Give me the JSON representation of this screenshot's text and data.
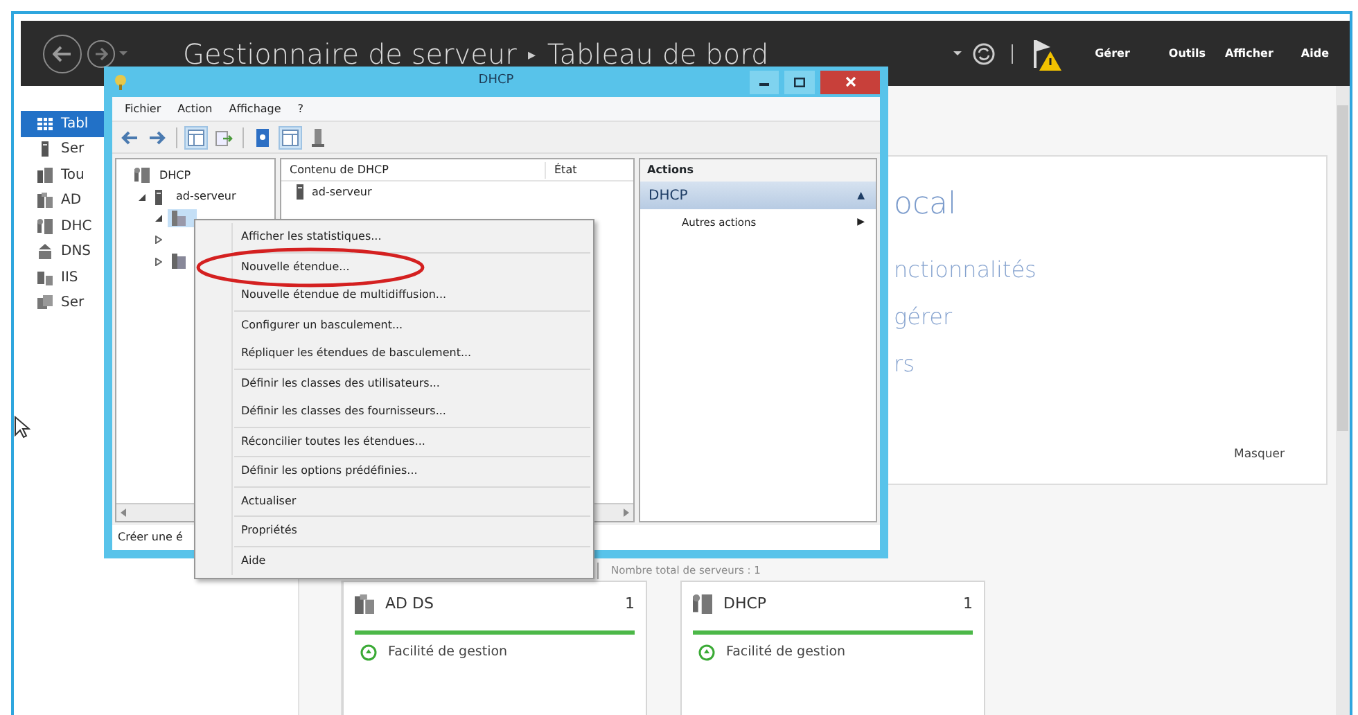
{
  "manager": {
    "breadcrumb": [
      "Gestionnaire de serveur",
      "Tableau de bord"
    ],
    "separator": "▸",
    "menu": [
      "Gérer",
      "Outils",
      "Afficher",
      "Aide"
    ],
    "sidebar": [
      {
        "label": "Tabl",
        "kind": "grid",
        "selected": true
      },
      {
        "label": "Ser",
        "kind": "server",
        "selected": false
      },
      {
        "label": "Tou",
        "kind": "servers",
        "selected": false
      },
      {
        "label": "AD",
        "kind": "adds",
        "selected": false
      },
      {
        "label": "DHC",
        "kind": "dhcp",
        "selected": false
      },
      {
        "label": "DNS",
        "kind": "dns",
        "selected": false
      },
      {
        "label": "IIS",
        "kind": "iis",
        "selected": false
      },
      {
        "label": "Ser",
        "kind": "files",
        "selected": false
      }
    ],
    "welcome": {
      "heading": "ocal",
      "links": [
        "nctionnalités",
        "gérer",
        "rs"
      ],
      "hide": "Masquer"
    },
    "server_count": "Nombre total de serveurs : 1",
    "tiles": [
      {
        "title": "AD DS",
        "count": "1",
        "kind": "adds",
        "status": "Facilité de gestion",
        "healthy": true
      },
      {
        "title": "DHCP",
        "count": "1",
        "kind": "dhcp",
        "status": "Facilité de gestion",
        "healthy": true
      }
    ]
  },
  "dhcp_window": {
    "title": "DHCP",
    "menu": [
      "Fichier",
      "Action",
      "Affichage",
      "?"
    ],
    "tree": [
      {
        "label": "DHCP",
        "kind": "dhcp",
        "selected": false,
        "children": [
          {
            "label": "ad-serveur",
            "kind": "server",
            "expanded": true,
            "selected": false,
            "children": [
              {
                "kind": "ipv4",
                "expanded": true,
                "selected": true
              },
              {
                "expanded": false,
                "selected": false
              },
              {
                "kind": "ipv6",
                "expanded": false,
                "selected": false
              }
            ]
          }
        ]
      }
    ],
    "content": {
      "columns": [
        "Contenu de DHCP",
        "État"
      ],
      "rows": [
        {
          "name": "ad-serveur"
        }
      ]
    },
    "actions": {
      "header": "Actions",
      "section": "DHCP",
      "section_caret": "▲",
      "items": [
        {
          "label": "Autres actions",
          "arrow": "▶"
        }
      ]
    },
    "status": "Créer une é"
  },
  "context_menu": {
    "groups": [
      [
        {
          "label": "Afficher les statistiques...",
          "highlighted": false
        }
      ],
      [
        {
          "label": "Nouvelle étendue...",
          "highlighted": true
        },
        {
          "label": "Nouvelle étendue de multidiffusion...",
          "highlighted": false
        }
      ],
      [
        {
          "label": "Configurer un basculement...",
          "highlighted": false
        },
        {
          "label": "Répliquer les étendues de basculement...",
          "highlighted": false
        }
      ],
      [
        {
          "label": "Définir les classes des utilisateurs...",
          "highlighted": false
        },
        {
          "label": "Définir les classes des fournisseurs...",
          "highlighted": false
        }
      ],
      [
        {
          "label": "Réconcilier toutes les étendues...",
          "highlighted": false
        }
      ],
      [
        {
          "label": "Définir les options prédéfinies...",
          "highlighted": false
        }
      ],
      [
        {
          "label": "Actualiser",
          "highlighted": false
        }
      ],
      [
        {
          "label": "Propriétés",
          "highlighted": false
        }
      ],
      [
        {
          "label": "Aide",
          "highlighted": false
        }
      ]
    ]
  }
}
